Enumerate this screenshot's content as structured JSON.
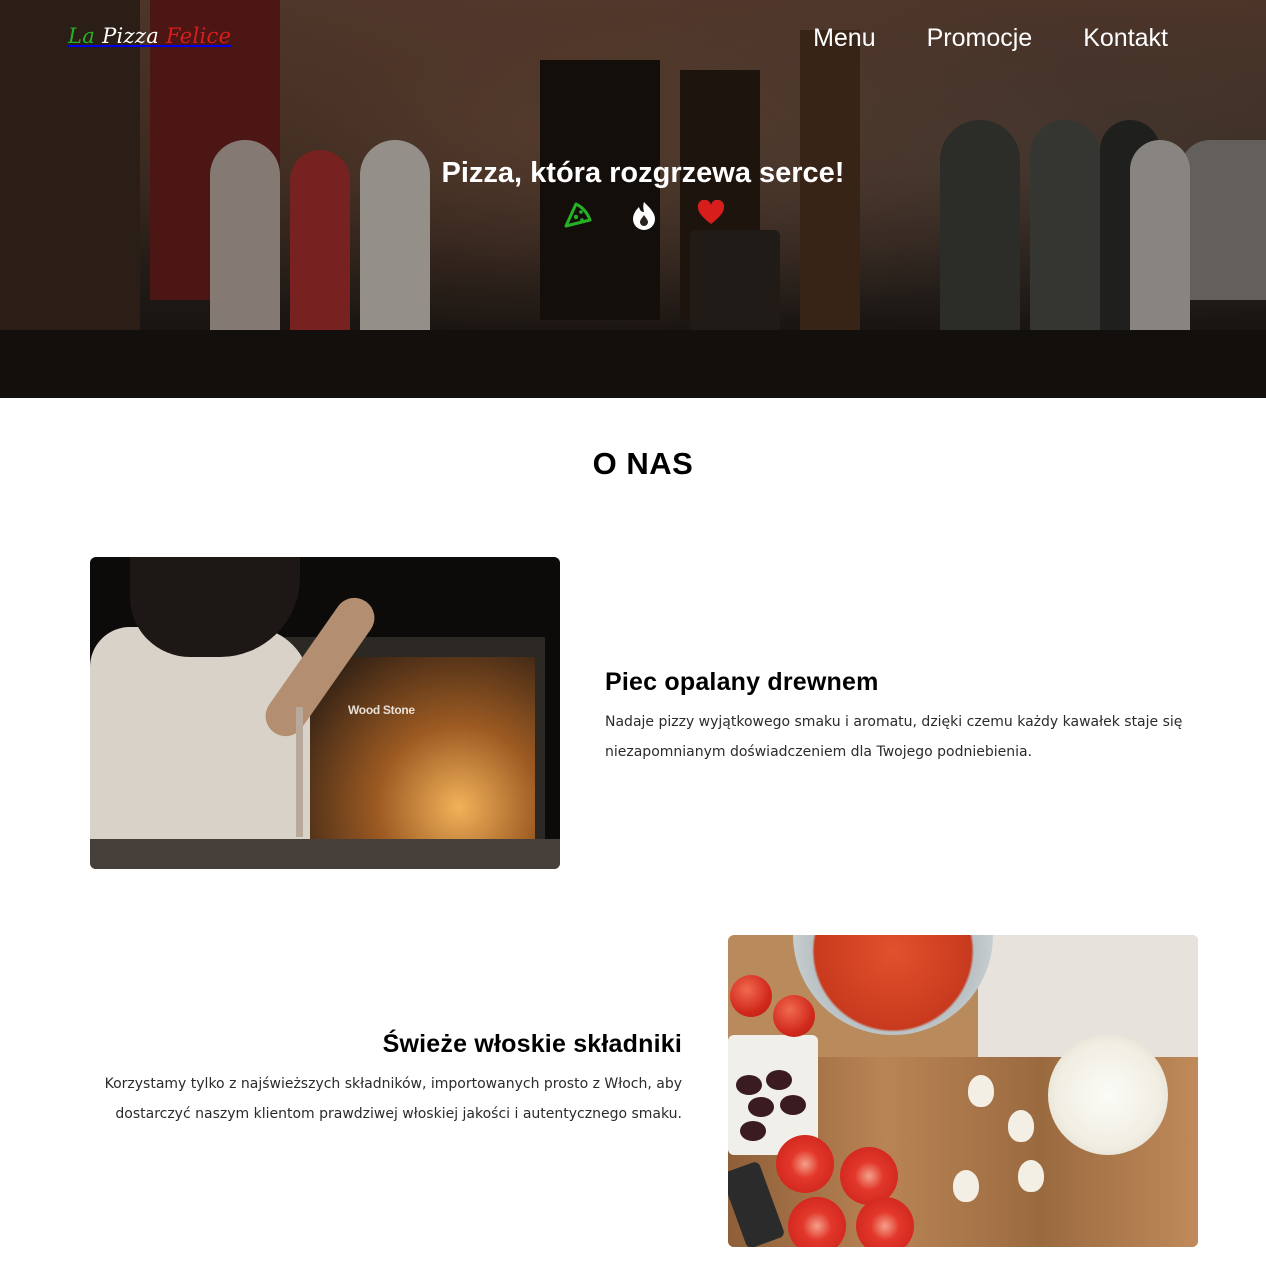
{
  "header": {
    "logo": {
      "part1": "La",
      "part2": "Pizza",
      "part3": "Felice"
    },
    "nav": [
      "Menu",
      "Promocje",
      "Kontakt"
    ]
  },
  "hero": {
    "title": "Pizza, która rozgrzewa serce!",
    "icons": [
      "pizza-slice-icon",
      "fire-icon",
      "heart-icon"
    ],
    "icon_colors": [
      "#26b026",
      "#ffffff",
      "#d81d1d"
    ]
  },
  "about": {
    "title": "O NAS",
    "features": [
      {
        "heading": "Piec opalany drewnem",
        "text": "Nadaje pizzy wyjątkowego smaku i aromatu, dzięki czemu każdy kawałek staje się niezapomnianym doświadczeniem dla Twojego podniebienia.",
        "image_label": "Wood Stone"
      },
      {
        "heading": "Świeże włoskie składniki",
        "text": "Korzystamy tylko z najświeższych składników, importowanych prosto z Włoch, aby dostarczyć naszym klientom prawdziwej włoskiej jakości i autentycznego smaku."
      }
    ]
  }
}
